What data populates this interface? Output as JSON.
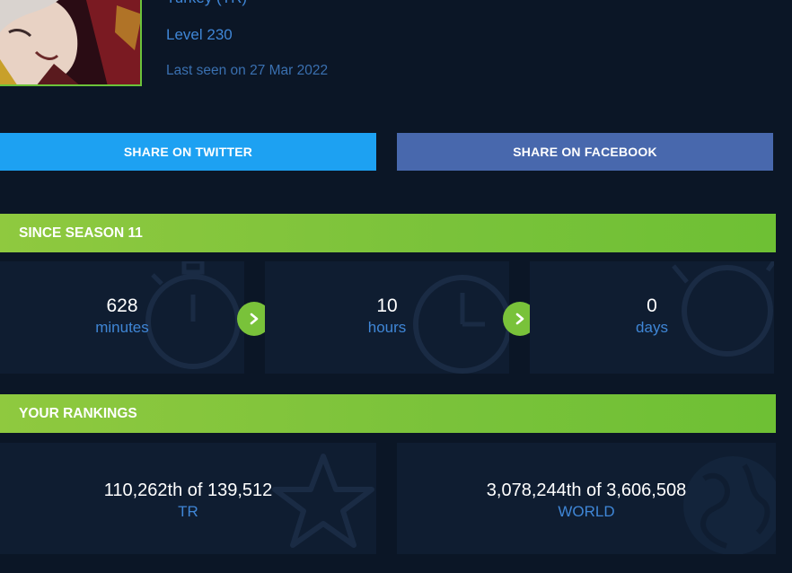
{
  "profile": {
    "country": "Turkey (TR)",
    "level": "Level 230",
    "last_seen": "Last seen on 27 Mar 2022"
  },
  "share": {
    "twitter_label": "SHARE ON TWITTER",
    "facebook_label": "SHARE ON FACEBOOK"
  },
  "season": {
    "header": "SINCE SEASON 11",
    "stats": [
      {
        "value": "628",
        "label": "minutes",
        "icon": "stopwatch-icon"
      },
      {
        "value": "10",
        "label": "hours",
        "icon": "clock-icon"
      },
      {
        "value": "0",
        "label": "days",
        "icon": "stopwatch-icon"
      }
    ]
  },
  "rankings": {
    "header": "YOUR RANKINGS",
    "items": [
      {
        "value": "110,262th of 139,512",
        "label": "TR",
        "icon": "star-icon"
      },
      {
        "value": "3,078,244th of 3,606,508",
        "label": "WORLD",
        "icon": "globe-icon"
      }
    ]
  },
  "colors": {
    "background": "#0b1626",
    "card": "#0f1d31",
    "accent_green": "#79c23a",
    "link_blue": "#3f86d6",
    "twitter": "#1da1f2",
    "facebook": "#4868ad"
  }
}
